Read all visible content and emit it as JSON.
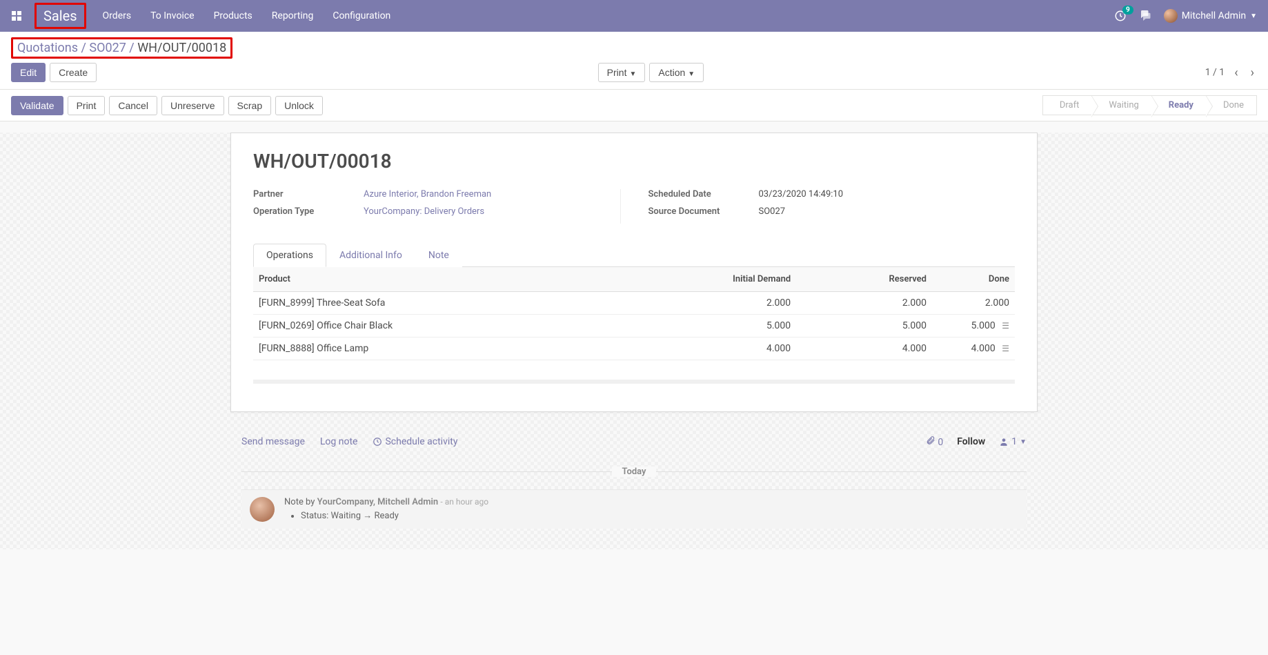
{
  "navbar": {
    "brand": "Sales",
    "items": [
      "Orders",
      "To Invoice",
      "Products",
      "Reporting",
      "Configuration"
    ],
    "notification_count": "9",
    "user_name": "Mitchell Admin"
  },
  "breadcrumb": {
    "parts": [
      "Quotations",
      "SO027",
      "WH/OUT/00018"
    ]
  },
  "cp_buttons": {
    "edit": "Edit",
    "create": "Create",
    "print": "Print",
    "action": "Action"
  },
  "pager": {
    "text": "1 / 1"
  },
  "action_buttons": [
    "Validate",
    "Print",
    "Cancel",
    "Unreserve",
    "Scrap",
    "Unlock"
  ],
  "status_steps": [
    "Draft",
    "Waiting",
    "Ready",
    "Done"
  ],
  "status_current": "Ready",
  "record": {
    "title": "WH/OUT/00018",
    "left": [
      {
        "label": "Partner",
        "value": "Azure Interior, Brandon Freeman",
        "link": true
      },
      {
        "label": "Operation Type",
        "value": "YourCompany: Delivery Orders",
        "link": true
      }
    ],
    "right": [
      {
        "label": "Scheduled Date",
        "value": "03/23/2020 14:49:10",
        "link": false
      },
      {
        "label": "Source Document",
        "value": "SO027",
        "link": false
      }
    ]
  },
  "tabs": [
    "Operations",
    "Additional Info",
    "Note"
  ],
  "active_tab": "Operations",
  "table": {
    "columns": [
      "Product",
      "Initial Demand",
      "Reserved",
      "Done"
    ],
    "rows": [
      {
        "product": "[FURN_8999] Three-Seat Sofa",
        "initial": "2.000",
        "reserved": "2.000",
        "done": "2.000",
        "has_detail": false
      },
      {
        "product": "[FURN_0269] Office Chair Black",
        "initial": "5.000",
        "reserved": "5.000",
        "done": "5.000",
        "has_detail": true
      },
      {
        "product": "[FURN_8888] Office Lamp",
        "initial": "4.000",
        "reserved": "4.000",
        "done": "4.000",
        "has_detail": true
      }
    ]
  },
  "chatter": {
    "actions": {
      "send": "Send message",
      "log": "Log note",
      "schedule": "Schedule activity"
    },
    "attachments": "0",
    "follow": "Follow",
    "followers": "1",
    "divider": "Today",
    "message": {
      "prefix": "Note by ",
      "author": "YourCompany, Mitchell Admin",
      "time": "an hour ago",
      "bullet_prefix": "Status: ",
      "from": "Waiting",
      "to": "Ready"
    }
  }
}
